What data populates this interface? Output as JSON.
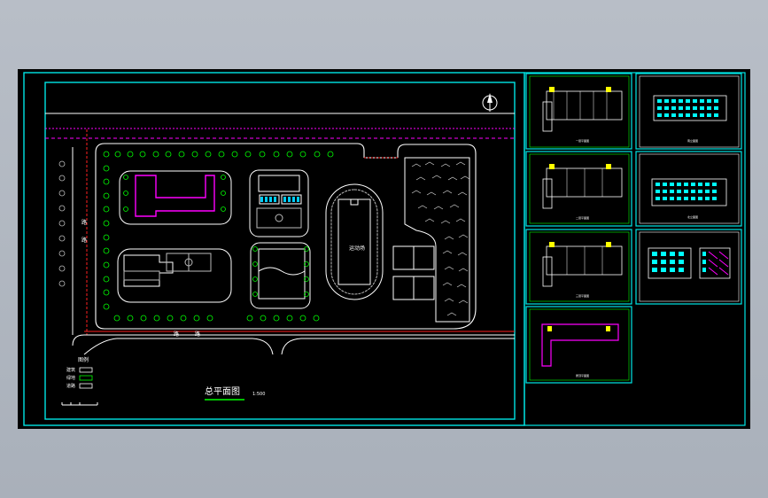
{
  "site_plan": {
    "title": "总平面图",
    "scale": "1:500",
    "road_label_west": "路",
    "road_label_south": "路",
    "road_tag": "道路",
    "track_label": "运动场",
    "legend_heading": "图例",
    "legend_items": [
      "建筑",
      "绿地",
      "道路"
    ]
  },
  "thumbnails": [
    {
      "id": "floor-1",
      "caption": "一层平面图"
    },
    {
      "id": "elev-south",
      "caption": "南立面图"
    },
    {
      "id": "floor-2",
      "caption": "二层平面图"
    },
    {
      "id": "elev-north",
      "caption": "北立面图"
    },
    {
      "id": "floor-3",
      "caption": "三层平面图"
    },
    {
      "id": "elev-side",
      "caption": "侧立面图"
    },
    {
      "id": "roof",
      "caption": "屋顶平面图"
    }
  ],
  "colors": {
    "background": "#000000",
    "frame": "#00e5e5",
    "road": "#ffffff",
    "tree": "#00ff00",
    "magenta": "#ff00ff",
    "red": "#ff2020",
    "window": "#00ffff",
    "outer": "#b3b9c2"
  }
}
